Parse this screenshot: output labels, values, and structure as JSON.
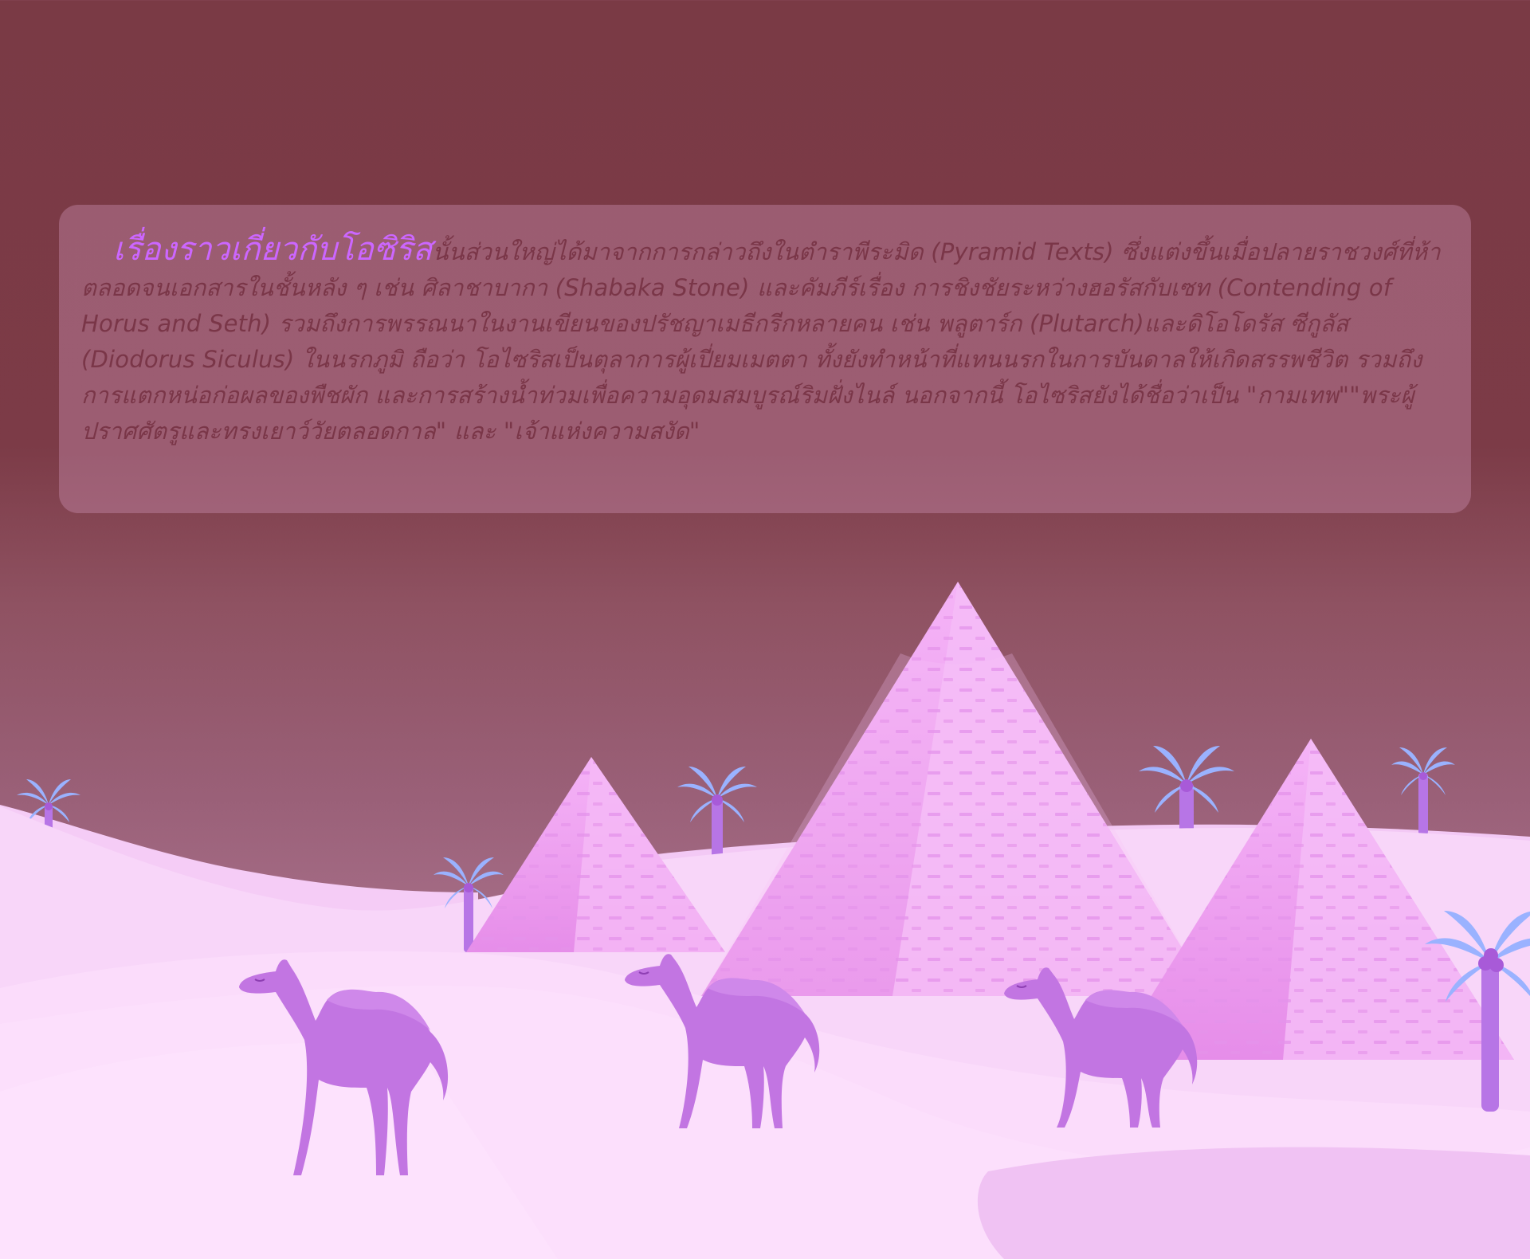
{
  "article": {
    "title": "เรื่องราวเกี่ยวกับโอซิริส",
    "body": "นั้นส่วนใหญ่ได้มาจากการกล่าวถึงในตำราพีระมิด (Pyramid Texts) ซึ่งแต่งขึ้นเมื่อปลายราชวงศ์ที่ห้า ตลอดจนเอกสารในชั้นหลัง ๆ เช่น ศิลาชาบากา (Shabaka Stone) และคัมภีร์เรื่อง การชิงชัยระหว่างฮอรัสกับเซท (Contending of Horus and Seth) รวมถึงการพรรณนาในงานเขียนของปรัชญาเมธีกรีกหลายคน เช่น พลูตาร์ก (Plutarch)และดิโอโดรัส ซีกูลัส (Diodorus Siculus)  ในนรกภูมิ ถือว่า โอไซริสเป็นตุลาการผู้เปี่ยมเมตตา ทั้งยังทำหน้าที่แทนนรกในการบันดาลให้เกิดสรรพชีวิต รวมถึง การแตกหน่อก่อผลของพืชผัก และการสร้างน้ำท่วมเพื่อความอุดมสมบูรณ์ริมฝั่งไนล์ นอกจากนี้ โอไซริสยังได้ชื่อว่าเป็น \"กามเทพ\"\"พระผู้ปราศศัตรูและทรงเยาว์วัยตลอดกาล\" และ \"เจ้าแห่งความสงัด\""
  },
  "scene": {
    "description_icons": [
      "pyramid-icon",
      "camel-icon",
      "palm-tree-icon",
      "sand-dune-icon"
    ],
    "colors": {
      "sky_top": "#7a3a45",
      "panel": "#c88caf",
      "title": "#cc66ff",
      "body_text": "#7a3648",
      "pyramid": "#ee9af2",
      "pyramid_shade": "#d977e6",
      "dune": "#f7d3f8",
      "camel": "#c275e2",
      "palm_leaf": "#9ab2ff",
      "palm_trunk": "#b775e6"
    }
  }
}
